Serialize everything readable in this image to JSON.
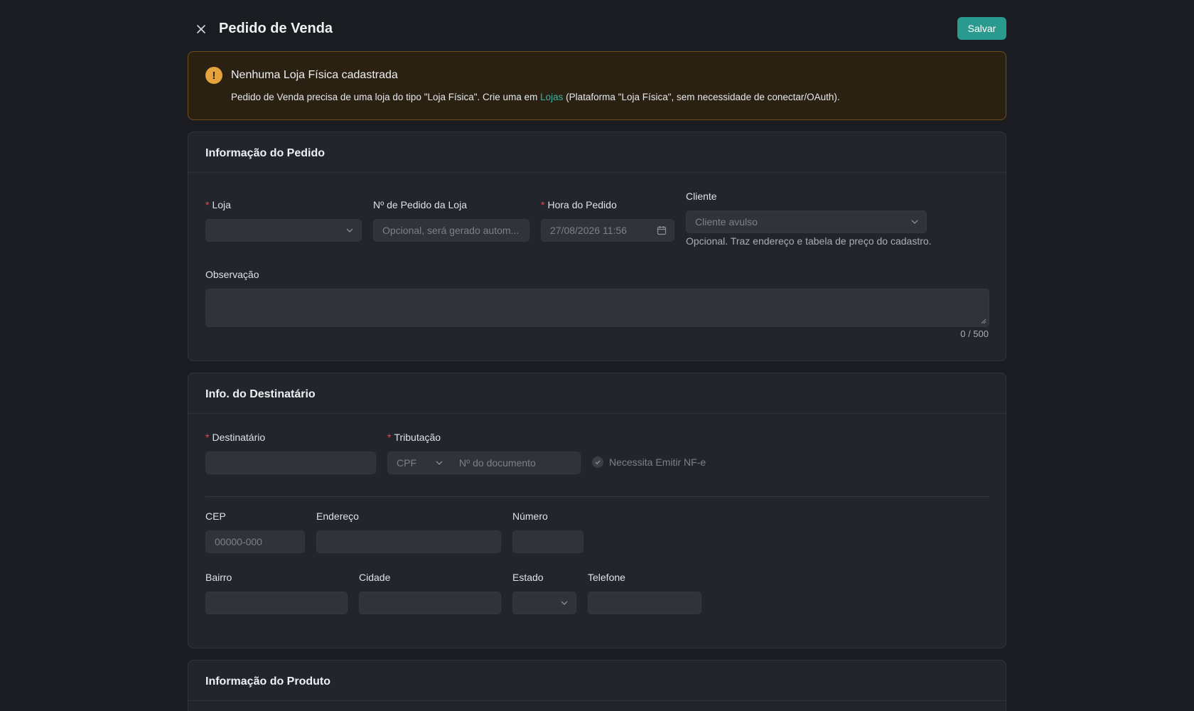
{
  "header": {
    "title": "Pedido de Venda",
    "save_label": "Salvar"
  },
  "alert": {
    "title": "Nenhuma Loja Física cadastrada",
    "desc_before": "Pedido de Venda precisa de uma loja do tipo \"Loja Física\". Crie uma em ",
    "link": "Lojas",
    "desc_after": " (Plataforma \"Loja Física\", sem necessidade de conectar/OAuth)."
  },
  "pedido": {
    "title": "Informação do Pedido",
    "loja_label": "Loja",
    "numero_label": "Nº de Pedido da Loja",
    "numero_placeholder": "Opcional, será gerado autom...",
    "hora_label": "Hora do Pedido",
    "hora_value": "27/08/2026 11:56",
    "cliente_label": "Cliente",
    "cliente_placeholder": "Cliente avulso",
    "cliente_help": "Opcional. Traz endereço e tabela de preço do cadastro.",
    "obs_label": "Observação",
    "obs_counter": "0 / 500"
  },
  "destinatario": {
    "title": "Info. do Destinatário",
    "dest_label": "Destinatário",
    "trib_label": "Tributação",
    "trib_type": "CPF",
    "doc_placeholder": "Nº do documento",
    "nfe_label": "Necessita Emitir NF-e",
    "cep_label": "CEP",
    "cep_placeholder": "00000-000",
    "endereco_label": "Endereço",
    "numero_label": "Número",
    "bairro_label": "Bairro",
    "cidade_label": "Cidade",
    "estado_label": "Estado",
    "telefone_label": "Telefone"
  },
  "produto": {
    "title": "Informação do Produto"
  }
}
